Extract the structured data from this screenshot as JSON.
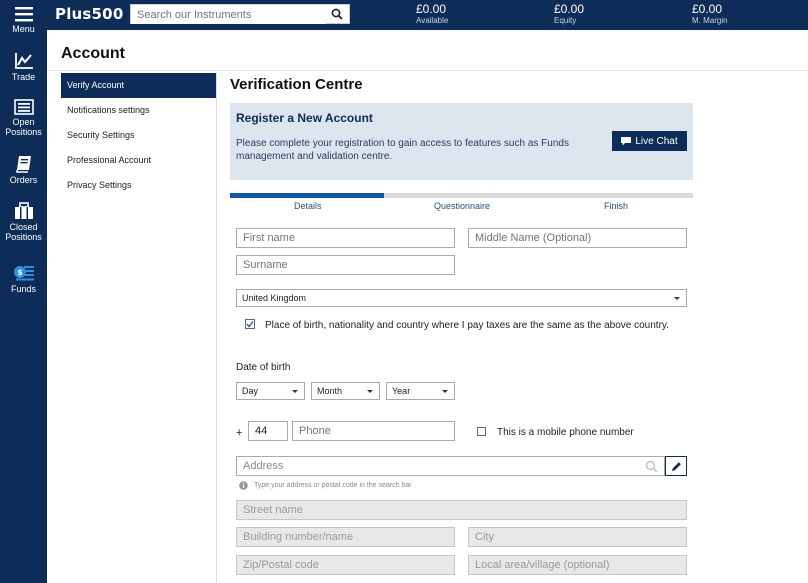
{
  "nav": {
    "items": [
      {
        "label": "Menu",
        "icon": "hamburger-icon"
      },
      {
        "label": "Trade",
        "icon": "chart-line-icon"
      },
      {
        "label": "Open Positions",
        "icon": "list-icon"
      },
      {
        "label": "Orders",
        "icon": "notebook-icon"
      },
      {
        "label": "Closed Positions",
        "icon": "briefcase-icon"
      },
      {
        "label": "Funds",
        "icon": "funds-icon"
      }
    ]
  },
  "header": {
    "logo": "Plus500",
    "search_placeholder": "Search our Instruments",
    "metrics": [
      {
        "value": "£0.00",
        "label": "Available"
      },
      {
        "value": "£0.00",
        "label": "Equity"
      },
      {
        "value": "£0.00",
        "label": "M. Margin"
      }
    ]
  },
  "account": {
    "title": "Account",
    "menu": [
      "Verify Account",
      "Notifications settings",
      "Security Settings",
      "Professional Account",
      "Privacy Settings"
    ]
  },
  "main": {
    "title": "Verification Centre",
    "banner": {
      "heading": "Register a New Account",
      "text": "Please complete your registration to gain access to features such as Funds management and validation centre.",
      "live_chat": "Live Chat"
    },
    "steps": [
      "Details",
      "Questionnaire",
      "Finish"
    ],
    "progress": 0.333,
    "form": {
      "first_name": "First name",
      "middle_name": "Middle Name (Optional)",
      "surname": "Surname",
      "country": "United Kingdom",
      "same_country_label": "Place of birth, nationality and country where I pay taxes are the same as the above country.",
      "dob_label": "Date of birth",
      "day": "Day",
      "month": "Month",
      "year": "Year",
      "plus": "+",
      "country_code": "44",
      "phone": "Phone",
      "mobile_label": "This is a mobile phone number",
      "address": "Address",
      "address_hint": "Type your address or postal code in the search bar",
      "street": "Street name",
      "building": "Building number/name",
      "city": "City",
      "zip": "Zip/Postal code",
      "local_area": "Local area/village (optional)"
    }
  }
}
